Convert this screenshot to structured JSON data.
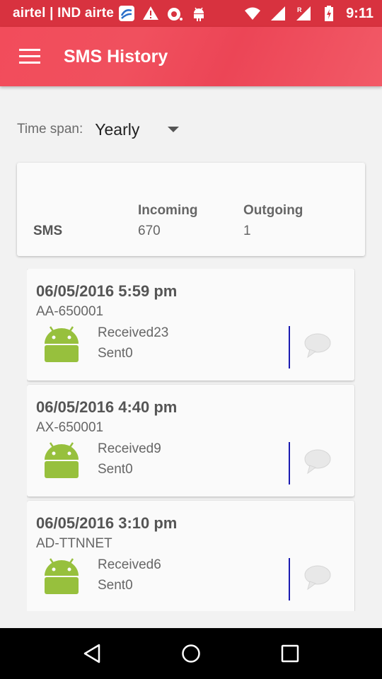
{
  "status_bar": {
    "carrier": "airtel | IND airte",
    "time": "9:11",
    "left_icons": [
      "data-transfer-icon",
      "warning-icon",
      "camera-icon",
      "android-icon"
    ],
    "right_icons": [
      "wifi-icon",
      "signal-icon",
      "roaming-signal-icon",
      "battery-icon"
    ],
    "color": "#d8323f"
  },
  "app_bar": {
    "title": "SMS History",
    "menu_icon": "hamburger-menu-icon",
    "color": "#f04c5a"
  },
  "filter": {
    "label": "Time span:",
    "value": "Yearly"
  },
  "summary": {
    "row_label": "SMS",
    "incoming_label": "Incoming",
    "incoming_value": "670",
    "outgoing_label": "Outgoing",
    "outgoing_value": "1"
  },
  "entries": [
    {
      "date": "06/05/2016 5:59 pm",
      "sender": "AA-650001",
      "received": "Received23",
      "sent": "Sent0"
    },
    {
      "date": "06/05/2016 4:40 pm",
      "sender": "AX-650001",
      "received": "Received9",
      "sent": "Sent0"
    },
    {
      "date": "06/05/2016 3:10 pm",
      "sender": "AD-TTNNET",
      "received": "Received6",
      "sent": "Sent0"
    }
  ],
  "nav_bar": {
    "buttons": [
      "back-icon",
      "home-icon",
      "recents-icon"
    ]
  }
}
